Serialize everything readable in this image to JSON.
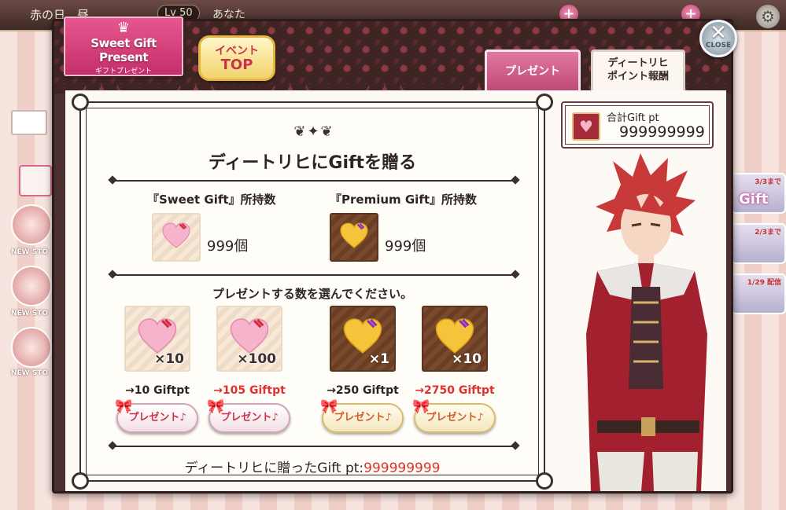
{
  "background": {
    "region_text": "赤の日　昼",
    "level": "Lv 50",
    "player_name": "あなた",
    "left_badges": [
      "NEW STO",
      "NEW STO",
      "NEW STO"
    ],
    "right_tiles": [
      {
        "tag": "3/3まで",
        "label": "Gift"
      },
      {
        "tag": "2/3まで",
        "label": ""
      },
      {
        "tag": "1/29 配信",
        "label": ""
      }
    ]
  },
  "logo": {
    "title": "Sweet Gift Present",
    "subtitle": "ギフトプレゼント"
  },
  "event_top": {
    "line1": "イベント",
    "line2": "TOP"
  },
  "tabs": {
    "present": "プレゼント",
    "reward_line1": "ディートリヒ",
    "reward_line2": "ポイント報酬"
  },
  "close_label": "CLOSE",
  "panel": {
    "title": "ディートリヒにGiftを贈る",
    "sweet_label": "『Sweet Gift』所持数",
    "sweet_count": "999個",
    "premium_label": "『Premium Gift』所持数",
    "premium_count": "999個",
    "choose_text": "プレゼントする数を選んでください。",
    "options": [
      {
        "qty": "×10",
        "cost": "→10 Giftpt",
        "button": "プレゼント♪"
      },
      {
        "qty": "×100",
        "cost": "→105 Giftpt",
        "button": "プレゼント♪"
      },
      {
        "qty": "×1",
        "cost": "→250 Giftpt",
        "button": "プレゼント♪"
      },
      {
        "qty": "×10",
        "cost": "→2750 Giftpt",
        "button": "プレゼント♪"
      }
    ],
    "total_label": "ディートリヒに贈ったGift pt:",
    "total_value": "999999999"
  },
  "gift_pt": {
    "label": "合計Gift pt",
    "value": "999999999"
  },
  "colors": {
    "accent_pink": "#c42f69",
    "highlight_red": "#e03030",
    "dialog_frame": "#4a2f2c"
  }
}
